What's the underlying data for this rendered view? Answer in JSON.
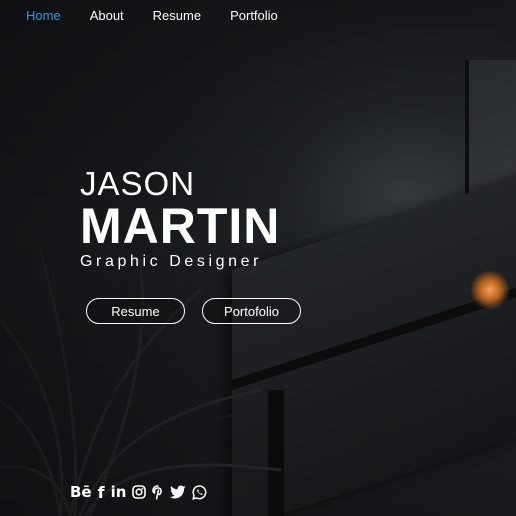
{
  "nav": {
    "items": [
      {
        "label": "Home",
        "active": true
      },
      {
        "label": "About",
        "active": false
      },
      {
        "label": "Resume",
        "active": false
      },
      {
        "label": "Portfolio",
        "active": false
      }
    ]
  },
  "hero": {
    "first_name": "JASON",
    "last_name": "MARTIN",
    "role": "Graphic Designer"
  },
  "buttons": {
    "resume_label": "Resume",
    "portfolio_label": "Portofolio"
  },
  "social": {
    "icons": [
      "behance-icon",
      "facebook-icon",
      "linkedin-icon",
      "instagram-icon",
      "pinterest-icon",
      "twitter-icon",
      "whatsapp-icon"
    ]
  },
  "colors": {
    "accent": "#2f9bd6",
    "text": "#ffffff",
    "background": "#131517"
  }
}
